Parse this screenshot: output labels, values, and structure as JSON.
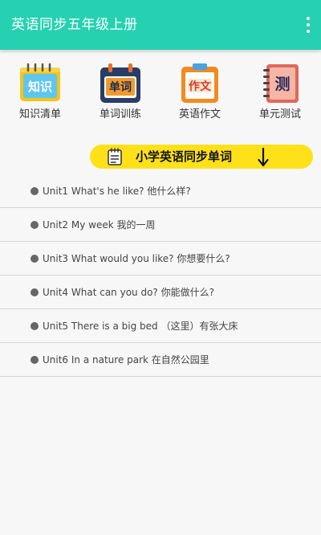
{
  "app": {
    "title": "英语同步五年级上册"
  },
  "shortcuts": [
    {
      "label": "知识清单",
      "icon_text": "知识",
      "icon": "knowledge-book-icon",
      "color": "#f5c518"
    },
    {
      "label": "单词训练",
      "icon_text": "单词",
      "icon": "word-calendar-icon",
      "color": "#2a3d66"
    },
    {
      "label": "英语作文",
      "icon_text": "作文",
      "icon": "composition-clipboard-icon",
      "color": "#f28b1e"
    },
    {
      "label": "单元测试",
      "icon_text": "测",
      "icon": "test-notebook-icon",
      "color": "#e0685c"
    }
  ],
  "banner": {
    "title": "小学英语同步单词"
  },
  "units": [
    "Unit1 What's he like? 他什么样?",
    "Unit2 My week 我的一周",
    "Unit3 What would you like? 你想要什么?",
    "Unit4 What can you do? 你能做什么?",
    "Unit5 There is a big bed （这里）有张大床",
    "Unit6 In a nature park 在自然公园里"
  ],
  "colors": {
    "accent": "#26d1b1",
    "banner": "#ffe11a"
  }
}
